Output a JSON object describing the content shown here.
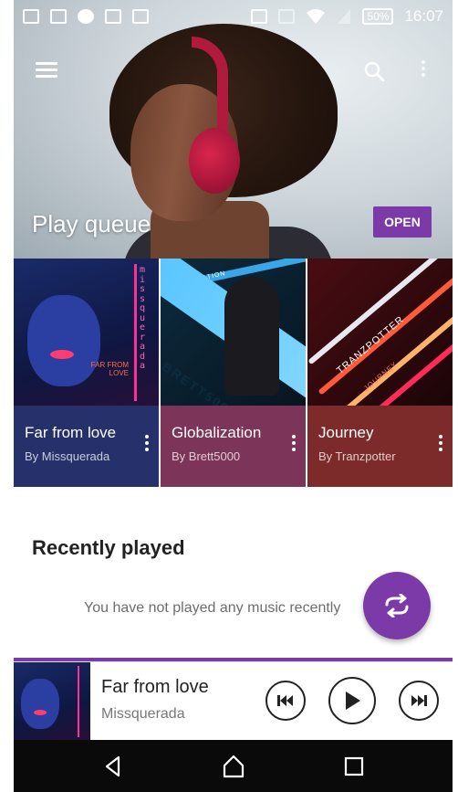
{
  "status_bar": {
    "battery": "50%",
    "time": "16:07",
    "icons": [
      "image-icon",
      "mail-icon",
      "info-icon",
      "clipboard-icon",
      "clipboard-check-icon",
      "nfc-icon",
      "sim-icon",
      "wifi-icon",
      "signal-icon"
    ]
  },
  "hero": {
    "title": "Play queue",
    "open_label": "OPEN"
  },
  "albums": [
    {
      "title": "Far from love",
      "artist": "By Missquerada",
      "art_text": "missquerada",
      "art_sub": "FAR FROM LOVE",
      "color": "#26306b"
    },
    {
      "title": "Globalization",
      "artist": "By Brett5000",
      "art_text": "BRETT5000",
      "art_sub": "GLOBALIZATION",
      "color": "#7c3458"
    },
    {
      "title": "Journey",
      "artist": "By Tranzpotter",
      "art_text": "TRANZPOTTER",
      "art_sub": "JOURNEY",
      "color": "#7d2b2a"
    }
  ],
  "recent": {
    "title": "Recently played",
    "empty_text": "You have not played any music recently"
  },
  "now_playing": {
    "title": "Far from love",
    "artist": "Missquerada",
    "progress": 1.0
  },
  "colors": {
    "accent": "#7b3aa8",
    "navbar": "#0a0a0a"
  }
}
